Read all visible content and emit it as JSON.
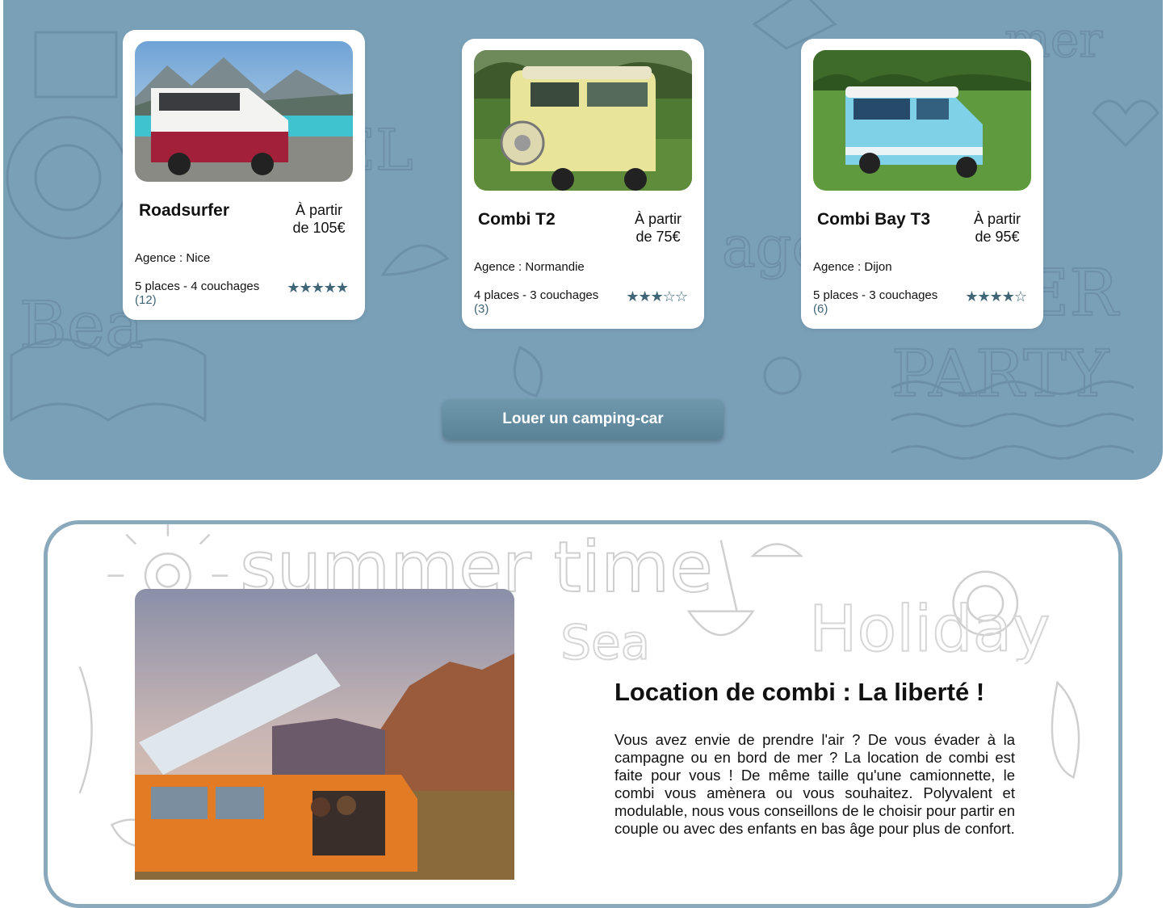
{
  "cards": [
    {
      "name": "Roadsurfer",
      "price": "À partir de 105€",
      "agency": "Agence : Nice",
      "capacity": "5 places - 4 couchages",
      "stars": "★★★★★",
      "reviews": "(12)"
    },
    {
      "name": "Combi T2",
      "price": "À partir de 75€",
      "agency": "Agence : Normandie",
      "capacity": "4 places - 3 couchages",
      "stars": "★★★☆☆",
      "reviews": "(3)"
    },
    {
      "name": "Combi Bay T3",
      "price": "À partir de 95€",
      "agency": "Agence : Dijon",
      "capacity": "5 places - 3 couchages",
      "stars": "★★★★☆",
      "reviews": "(6)"
    }
  ],
  "cta": {
    "label": "Louer un camping-car"
  },
  "about": {
    "title": "Location de combi : La liberté !",
    "body": "Vous avez envie de prendre l'air ? De vous évader à la campagne ou en bord de mer ? La location de combi est faite pour vous ! De même taille qu'une camionnette, le combi vous amènera ou vous souhaitez. Polyvalent et modulable, nous vous conseillons de le choisir pour partir en couple ou avec des enfants en bas âge pour plus de confort."
  },
  "colors": {
    "hero_bg": "#7aa0b8",
    "accent": "#3f6577",
    "border": "#8aa9bc"
  }
}
